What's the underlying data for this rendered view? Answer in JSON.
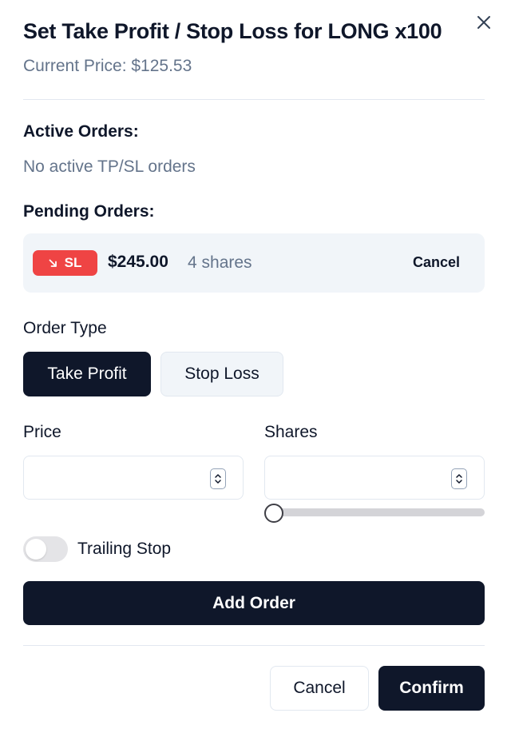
{
  "dialog": {
    "title": "Set Take Profit / Stop Loss for LONG x100",
    "current_price": "Current Price: $125.53",
    "close_icon": "close-icon"
  },
  "active_orders": {
    "heading": "Active Orders:",
    "empty_text": "No active TP/SL orders"
  },
  "pending_orders": {
    "heading": "Pending Orders:",
    "items": [
      {
        "type_label": "SL",
        "type_icon": "arrow-down-right-icon",
        "price": "$245.00",
        "shares": "4 shares",
        "cancel_label": "Cancel",
        "badge_color": "#ef4444"
      }
    ]
  },
  "order_type": {
    "label": "Order Type",
    "options": [
      "Take Profit",
      "Stop Loss"
    ],
    "selected": "Take Profit"
  },
  "form": {
    "price_label": "Price",
    "price_value": "",
    "shares_label": "Shares",
    "shares_value": "",
    "shares_slider_fraction": 0,
    "trailing_stop_label": "Trailing Stop",
    "trailing_stop_enabled": false,
    "add_order_label": "Add Order"
  },
  "footer": {
    "cancel_label": "Cancel",
    "confirm_label": "Confirm"
  },
  "colors": {
    "primary": "#0f172a",
    "muted_text": "#64748b",
    "stop_loss": "#ef4444"
  }
}
